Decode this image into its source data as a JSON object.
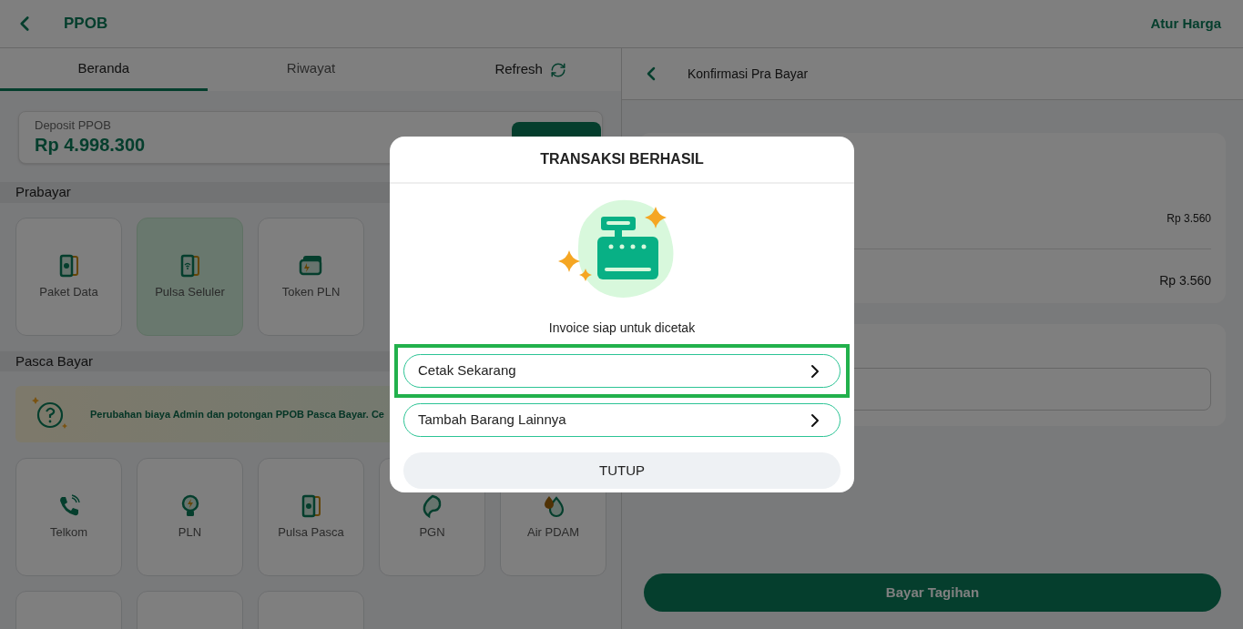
{
  "header": {
    "title": "PPOB",
    "action": "Atur Harga"
  },
  "tabs": [
    {
      "label": "Beranda",
      "selected": true
    },
    {
      "label": "Riwayat",
      "selected": false
    }
  ],
  "refresh": "Refresh",
  "deposit": {
    "label": "Deposit PPOB",
    "amount": "Rp 4.998.300"
  },
  "prabayar": {
    "title": "Prabayar",
    "items": [
      {
        "label": "Paket Data",
        "selected": false
      },
      {
        "label": "Pulsa Seluler",
        "selected": true
      },
      {
        "label": "Token PLN",
        "selected": false
      }
    ]
  },
  "pasca_bayar": {
    "title": "Pasca Bayar",
    "notice": "Perubahan biaya Admin dan potongan PPOB Pasca Bayar. Ce",
    "items": [
      {
        "label": "Telkom",
        "selected": false
      },
      {
        "label": "PLN",
        "selected": false
      },
      {
        "label": "Pulsa Pasca",
        "selected": false
      },
      {
        "label": "PGN",
        "selected": false
      },
      {
        "label": "Air PDAM",
        "selected": false
      },
      {
        "selected": false
      },
      {
        "selected": false
      },
      {
        "selected": false
      }
    ]
  },
  "confirm": {
    "title": "Konfirmasi Pra Bayar",
    "rows": [
      {
        "kind": "item",
        "value": "Rp 3.560"
      },
      {
        "kind": "total",
        "value": "Rp 3.560"
      }
    ],
    "pay_button": "Bayar Tagihan"
  },
  "modal": {
    "title": "TRANSAKSI BERHASIL",
    "message": "Invoice siap untuk dicetak",
    "options": [
      {
        "label": "Cetak Sekarang",
        "highlighted": true
      },
      {
        "label": "Tambah Barang Lainnya",
        "highlighted": false
      }
    ],
    "close": "TUTUP"
  }
}
